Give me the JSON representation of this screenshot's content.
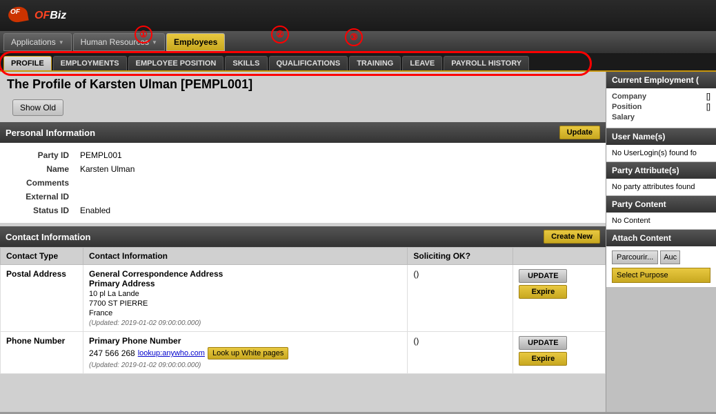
{
  "app": {
    "logo": "OFBiz",
    "logo_of": "OF",
    "logo_biz": "Biz"
  },
  "navbar": {
    "items": [
      {
        "label": "Applications",
        "active": false,
        "has_dropdown": true
      },
      {
        "label": "Human Resources",
        "active": false,
        "has_dropdown": true
      },
      {
        "label": "Employees",
        "active": true,
        "has_dropdown": false
      }
    ]
  },
  "subtabs": {
    "items": [
      {
        "label": "PROFILE",
        "active": true
      },
      {
        "label": "EMPLOYMENTS",
        "active": false
      },
      {
        "label": "EMPLOYEE POSITION",
        "active": false
      },
      {
        "label": "SKILLS",
        "active": false
      },
      {
        "label": "QUALIFICATIONS",
        "active": false
      },
      {
        "label": "TRAINING",
        "active": false
      },
      {
        "label": "LEAVE",
        "active": false
      },
      {
        "label": "PAYROLL HISTORY",
        "active": false
      }
    ]
  },
  "page": {
    "title": "The Profile of Karsten Ulman [PEMPL001]",
    "show_old_label": "Show Old"
  },
  "personal_info": {
    "section_title": "Personal Information",
    "update_btn": "Update",
    "fields": {
      "party_id_label": "Party ID",
      "party_id_value": "PEMPL001",
      "name_label": "Name",
      "name_value": "Karsten Ulman",
      "comments_label": "Comments",
      "external_id_label": "External ID",
      "status_id_label": "Status ID",
      "status_id_value": "Enabled"
    }
  },
  "contact_info": {
    "section_title": "Contact Information",
    "create_new_btn": "Create New",
    "col_contact_type": "Contact Type",
    "col_contact_info": "Contact Information",
    "col_soliciting": "Soliciting OK?",
    "postal_row": {
      "type": "Postal Address",
      "primary_label": "General Correspondence Address",
      "secondary_label": "Primary Address",
      "address_lines": [
        "10 pl La Lande",
        "7700 ST PIERRE",
        "France"
      ],
      "updated": "(Updated: 2019-01-02 09:00:00.000)",
      "soliciting": "()",
      "update_btn": "UPDATE",
      "expire_btn": "Expire"
    },
    "phone_row": {
      "type": "Phone Number",
      "primary_label": "Primary Phone Number",
      "phone_number": "247 566 268",
      "anywho_link": "lookup:anywho.com",
      "whitepages_btn": "Look up White pages",
      "updated": "(Updated: 2019-01-02 09:00:00.000)",
      "soliciting": "()",
      "update_btn": "UPDATE",
      "expire_btn": "Expire"
    }
  },
  "right_panel": {
    "employment": {
      "title": "Current Employment (",
      "company_label": "Company",
      "company_value": "[]",
      "position_label": "Position",
      "position_value": "[]",
      "salary_label": "Salary"
    },
    "usernames": {
      "title": "User Name(s)",
      "no_login_msg": "No UserLogin(s) found fo"
    },
    "party_attributes": {
      "title": "Party Attribute(s)",
      "no_attr_msg": "No party attributes found"
    },
    "party_content": {
      "title": "Party Content",
      "no_content_msg": "No Content"
    },
    "attach_content": {
      "title": "Attach Content",
      "browse_btn": "Parcourir...",
      "auc_btn": "Auc",
      "select_purpose": "Select Purpose"
    }
  },
  "annotations": {
    "circle1": "①",
    "circle2": "②",
    "circle3": "③"
  }
}
